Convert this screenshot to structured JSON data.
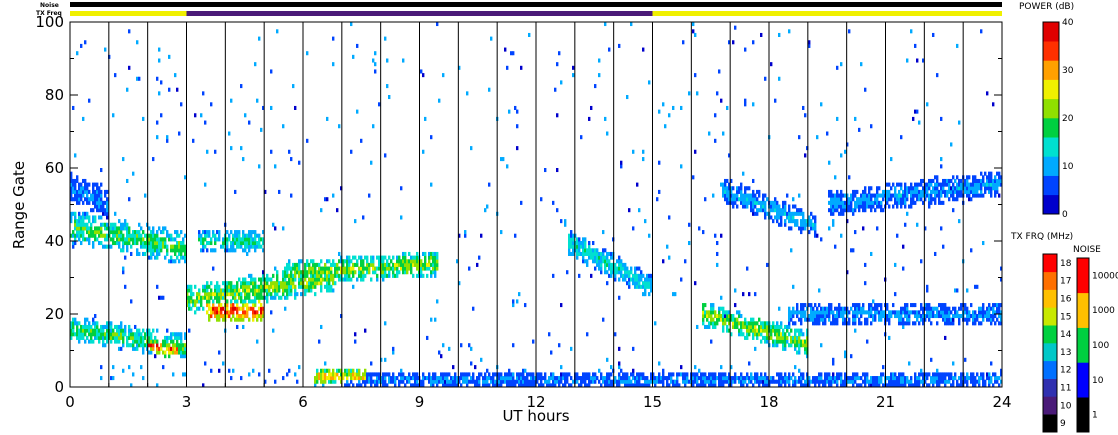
{
  "chart_data": {
    "type": "heatmap",
    "xlabel": "UT hours",
    "ylabel": "Range Gate",
    "xlim": [
      0,
      24
    ],
    "ylim": [
      0,
      100
    ],
    "x_ticks": [
      "0",
      "3",
      "6",
      "9",
      "12",
      "15",
      "18",
      "21",
      "24"
    ],
    "y_ticks": [
      "0",
      "20",
      "40",
      "60",
      "80",
      "100"
    ],
    "top_bars": {
      "noise_label": "Noise",
      "txfreq_label": "TX Freq",
      "noise_segments": [
        {
          "start": 0,
          "end": 24,
          "color": "#000000"
        }
      ],
      "txfreq_segments": [
        {
          "start": 0,
          "end": 3,
          "color": "#f0f000"
        },
        {
          "start": 3,
          "end": 15,
          "color": "#4a1a78"
        },
        {
          "start": 15,
          "end": 24,
          "color": "#f0f000"
        }
      ]
    },
    "scan_boundaries": [
      1,
      2,
      3,
      4,
      5,
      6,
      7,
      8,
      9,
      10,
      11,
      12,
      13,
      14,
      15,
      16,
      17,
      18,
      19,
      20,
      21,
      22,
      23
    ],
    "echo_bands": [
      {
        "t0": 0.0,
        "t1": 3.0,
        "y0": 44,
        "y1": 38,
        "w": 4.5,
        "p": 17
      },
      {
        "t0": 0.0,
        "t1": 3.0,
        "y0": 16,
        "y1": 11,
        "w": 3.5,
        "p": 17
      },
      {
        "t0": 2.0,
        "t1": 2.8,
        "y0": 12,
        "y1": 10,
        "w": 2.5,
        "p": 30
      },
      {
        "t0": 3.0,
        "t1": 6.8,
        "y0": 24,
        "y1": 30,
        "w": 4,
        "p": 20
      },
      {
        "t0": 3.5,
        "t1": 5.0,
        "y0": 21,
        "y1": 21,
        "w": 3,
        "p": 32
      },
      {
        "t0": 3.3,
        "t1": 5.0,
        "y0": 40,
        "y1": 40,
        "w": 3,
        "p": 15
      },
      {
        "t0": 5.5,
        "t1": 9.5,
        "y0": 31,
        "y1": 34,
        "w": 3.5,
        "p": 20
      },
      {
        "t0": 6.3,
        "t1": 7.6,
        "y0": 3,
        "y1": 3,
        "w": 2.5,
        "p": 25
      },
      {
        "t0": 7.0,
        "t1": 24.0,
        "y0": 2,
        "y1": 2,
        "w": 2.5,
        "p": 8
      },
      {
        "t0": 12.8,
        "t1": 15.0,
        "y0": 40,
        "y1": 27,
        "w": 3.5,
        "p": 13
      },
      {
        "t0": 16.3,
        "t1": 19.0,
        "y0": 20,
        "y1": 12,
        "w": 3.5,
        "p": 20
      },
      {
        "t0": 16.8,
        "t1": 19.2,
        "y0": 54,
        "y1": 44,
        "w": 3.5,
        "p": 10
      },
      {
        "t0": 18.5,
        "t1": 24.0,
        "y0": 20,
        "y1": 20,
        "w": 3,
        "p": 9
      },
      {
        "t0": 19.5,
        "t1": 24.0,
        "y0": 50,
        "y1": 56,
        "w": 3.5,
        "p": 9
      },
      {
        "t0": 0.0,
        "t1": 1.0,
        "y0": 55,
        "y1": 50,
        "w": 4,
        "p": 8
      }
    ],
    "colorbars": [
      {
        "title": "POWER (dB)",
        "range": [
          0,
          40
        ],
        "tick_labels": [
          "0",
          "10",
          "20",
          "30",
          "40"
        ],
        "colors": [
          "#0000cc",
          "#0044ff",
          "#00aaff",
          "#00e0d0",
          "#00d040",
          "#90e000",
          "#f0f000",
          "#ffa000",
          "#ff3000",
          "#e00000"
        ]
      },
      {
        "title": "TX FRQ (MHz)",
        "tick_labels": [
          "9",
          "10",
          "11",
          "12",
          "13",
          "14",
          "15",
          "16",
          "17",
          "18"
        ],
        "colors": [
          "#000000",
          "#4a1a78",
          "#3030b0",
          "#0070ff",
          "#00c8c8",
          "#00d040",
          "#c8e800",
          "#ffc000",
          "#ff7000",
          "#ff0000"
        ]
      },
      {
        "title": "NOISE",
        "tick_labels": [
          "1",
          "10",
          "100",
          "1000",
          "10000"
        ],
        "colors": [
          "#000000",
          "#0000ff",
          "#00d040",
          "#ffc000",
          "#ff0000"
        ]
      }
    ]
  }
}
